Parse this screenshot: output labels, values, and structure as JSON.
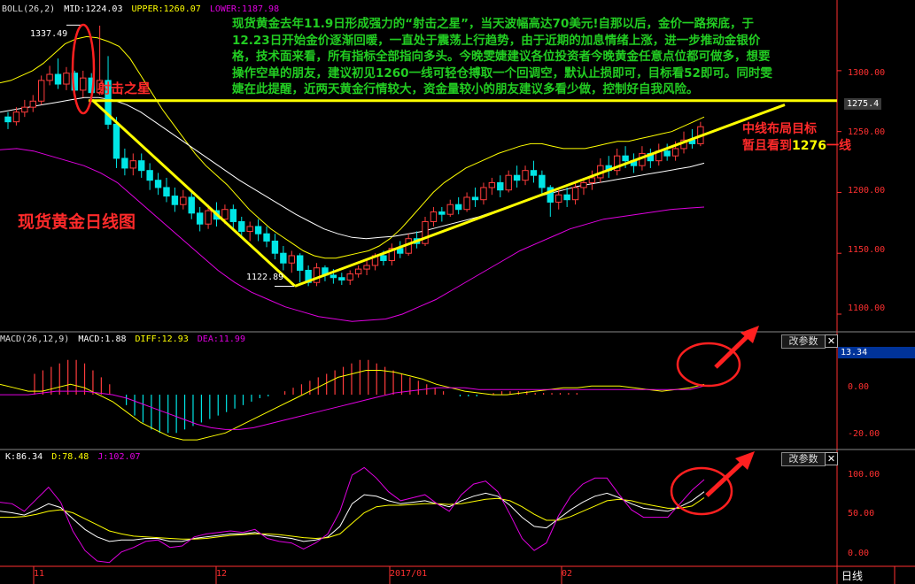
{
  "headers": {
    "boll": {
      "name": "BOLL(26,2)",
      "mid": "MID:1224.03",
      "upper": "UPPER:1260.07",
      "lower": "LOWER:1187.98"
    },
    "macd": {
      "name": "MACD(26,12,9)",
      "macd": "MACD:1.88",
      "diff": "DIFF:12.93",
      "dea": "DEA:11.99"
    },
    "kdj": {
      "k": "K:86.34",
      "d": "D:78.48",
      "j": "J:102.07"
    }
  },
  "buttons": {
    "params_label": "改参数",
    "close_label": "✕"
  },
  "annotations": {
    "main_text": "现货黄金去年11.9日形成强力的“射击之星”，当天波幅高达70美元!自那以后，金价一路探底，于12.23日开始金价逐渐回暖，一直处于震荡上行趋势，由于近期的加息情绪上涨，进一步推动金银价格，技术面来看，所有指标全部指向多头。今晚雯婕建议各位投资者今晚黄金任意点位都可做多，想要操作空单的朋友，建议初见1260一线可轻仓搏取一个回调空，默认止损即可，目标看52即可。同时雯婕在此提醒，近两天黄金行情较大，资金量较小的朋友建议多看少做，控制好自我风险。",
    "star_label": "射击之星",
    "chart_title": "现货黄金日线图",
    "target_line1": "中线布局目标",
    "target_line2_prefix": "暂且看到",
    "target_line2_value": "1276",
    "target_line2_suffix": "一线"
  },
  "price_labels": {
    "high": "1337.49",
    "low": "1122.89",
    "current": "1275.4",
    "macd_current": "13.34"
  },
  "axis": {
    "price_ticks": [
      "1300.00",
      "1250.00",
      "1200.00",
      "1150.00",
      "1100.00"
    ],
    "macd_ticks": [
      "0.00",
      "-20.00"
    ],
    "kdj_ticks": [
      "100.00",
      "50.00",
      "0.00"
    ],
    "time_labels": [
      "11",
      "12",
      "2017/01",
      "02"
    ],
    "period_label": "日线"
  },
  "colors": {
    "up": "#ff3c3c",
    "down": "#00e5e5",
    "yellow": "#ffff00",
    "mid": "#ffffff",
    "lower": "#e000e0",
    "k": "#ffffff",
    "d": "#ffff00",
    "j": "#e000e0",
    "axis": "#ff3030",
    "red_mark": "#ff2020"
  },
  "chart_data": {
    "type": "candlestick",
    "price_range": [
      1092,
      1345
    ],
    "macd_range": [
      -30,
      27
    ],
    "kdj_range": [
      -13,
      122
    ],
    "candles": [
      [
        1262,
        1258,
        1252,
        1266
      ],
      [
        1258,
        1266,
        1255,
        1270
      ],
      [
        1266,
        1270,
        1262,
        1276
      ],
      [
        1270,
        1275,
        1266,
        1280
      ],
      [
        1275,
        1292,
        1272,
        1296
      ],
      [
        1292,
        1297,
        1288,
        1304
      ],
      [
        1297,
        1289,
        1285,
        1310
      ],
      [
        1289,
        1298,
        1284,
        1303
      ],
      [
        1298,
        1284,
        1280,
        1300
      ],
      [
        1284,
        1294,
        1278,
        1300
      ],
      [
        1294,
        1282,
        1276,
        1298
      ],
      [
        1282,
        1292,
        1280,
        1337
      ],
      [
        1292,
        1256,
        1252,
        1312
      ],
      [
        1256,
        1228,
        1220,
        1262
      ],
      [
        1228,
        1220,
        1214,
        1236
      ],
      [
        1220,
        1226,
        1214,
        1232
      ],
      [
        1226,
        1218,
        1212,
        1232
      ],
      [
        1218,
        1210,
        1202,
        1224
      ],
      [
        1210,
        1204,
        1198,
        1216
      ],
      [
        1204,
        1197,
        1192,
        1212
      ],
      [
        1197,
        1190,
        1184,
        1204
      ],
      [
        1190,
        1196,
        1186,
        1202
      ],
      [
        1196,
        1183,
        1178,
        1200
      ],
      [
        1183,
        1174,
        1168,
        1188
      ],
      [
        1174,
        1185,
        1170,
        1190
      ],
      [
        1185,
        1178,
        1172,
        1192
      ],
      [
        1178,
        1186,
        1174,
        1190
      ],
      [
        1186,
        1176,
        1170,
        1190
      ],
      [
        1176,
        1168,
        1164,
        1180
      ],
      [
        1168,
        1172,
        1160,
        1176
      ],
      [
        1172,
        1166,
        1160,
        1178
      ],
      [
        1166,
        1160,
        1155,
        1172
      ],
      [
        1160,
        1150,
        1145,
        1166
      ],
      [
        1150,
        1142,
        1136,
        1156
      ],
      [
        1142,
        1148,
        1134,
        1152
      ],
      [
        1148,
        1136,
        1126,
        1150
      ],
      [
        1136,
        1126,
        1123,
        1140
      ],
      [
        1126,
        1138,
        1123,
        1142
      ],
      [
        1138,
        1132,
        1127,
        1140
      ],
      [
        1132,
        1130,
        1125,
        1137
      ],
      [
        1130,
        1128,
        1124,
        1134
      ],
      [
        1128,
        1133,
        1124,
        1136
      ],
      [
        1133,
        1137,
        1130,
        1140
      ],
      [
        1137,
        1140,
        1132,
        1144
      ],
      [
        1140,
        1148,
        1136,
        1150
      ],
      [
        1148,
        1144,
        1140,
        1152
      ],
      [
        1144,
        1154,
        1140,
        1158
      ],
      [
        1154,
        1150,
        1146,
        1160
      ],
      [
        1150,
        1162,
        1148,
        1166
      ],
      [
        1162,
        1158,
        1154,
        1168
      ],
      [
        1158,
        1176,
        1156,
        1180
      ],
      [
        1176,
        1184,
        1172,
        1188
      ],
      [
        1184,
        1182,
        1176,
        1188
      ],
      [
        1182,
        1190,
        1180,
        1194
      ],
      [
        1190,
        1186,
        1182,
        1196
      ],
      [
        1186,
        1196,
        1184,
        1200
      ],
      [
        1196,
        1194,
        1188,
        1204
      ],
      [
        1194,
        1204,
        1190,
        1208
      ],
      [
        1204,
        1208,
        1198,
        1212
      ],
      [
        1208,
        1202,
        1196,
        1214
      ],
      [
        1202,
        1214,
        1200,
        1218
      ],
      [
        1214,
        1210,
        1204,
        1222
      ],
      [
        1210,
        1218,
        1206,
        1222
      ],
      [
        1218,
        1214,
        1208,
        1226
      ],
      [
        1214,
        1204,
        1198,
        1218
      ],
      [
        1204,
        1192,
        1180,
        1206
      ],
      [
        1192,
        1198,
        1186,
        1202
      ],
      [
        1198,
        1194,
        1188,
        1204
      ],
      [
        1194,
        1204,
        1190,
        1208
      ],
      [
        1204,
        1208,
        1198,
        1212
      ],
      [
        1208,
        1212,
        1202,
        1218
      ],
      [
        1212,
        1222,
        1208,
        1228
      ],
      [
        1222,
        1218,
        1212,
        1230
      ],
      [
        1218,
        1230,
        1214,
        1236
      ],
      [
        1230,
        1226,
        1220,
        1238
      ],
      [
        1226,
        1222,
        1216,
        1232
      ],
      [
        1222,
        1232,
        1218,
        1238
      ],
      [
        1232,
        1226,
        1220,
        1236
      ],
      [
        1226,
        1234,
        1222,
        1240
      ],
      [
        1234,
        1230,
        1226,
        1240
      ],
      [
        1230,
        1236,
        1226,
        1242
      ],
      [
        1236,
        1243,
        1232,
        1250
      ],
      [
        1243,
        1240,
        1236,
        1252
      ],
      [
        1240,
        1254,
        1238,
        1258
      ]
    ],
    "boll_upper": [
      1290,
      1292,
      1296,
      1300,
      1306,
      1314,
      1322,
      1326,
      1328,
      1327,
      1324,
      1320,
      1310,
      1296,
      1282,
      1268,
      1256,
      1244,
      1232,
      1222,
      1214,
      1206,
      1196,
      1186,
      1178,
      1170,
      1164,
      1158,
      1152,
      1148,
      1146,
      1146,
      1148,
      1150,
      1152,
      1156,
      1162,
      1170,
      1180,
      1190,
      1200,
      1208,
      1214,
      1220,
      1224,
      1228,
      1232,
      1235,
      1238,
      1240,
      1240,
      1238,
      1236,
      1236,
      1236,
      1238,
      1240,
      1242,
      1242,
      1244,
      1246,
      1248,
      1250,
      1254,
      1258,
      1262
    ],
    "boll_mid": [
      1266,
      1268,
      1270,
      1272,
      1274,
      1276,
      1278,
      1278,
      1276,
      1272,
      1266,
      1258,
      1250,
      1242,
      1234,
      1226,
      1218,
      1210,
      1203,
      1196,
      1189,
      1182,
      1176,
      1170,
      1166,
      1163,
      1162,
      1163,
      1164,
      1166,
      1168,
      1171,
      1174,
      1177,
      1180,
      1184,
      1188,
      1192,
      1196,
      1199,
      1202,
      1205,
      1207,
      1209,
      1211,
      1213,
      1215,
      1217,
      1219,
      1221,
      1224
    ],
    "boll_lower": [
      1235,
      1236,
      1234,
      1230,
      1226,
      1222,
      1216,
      1208,
      1196,
      1184,
      1172,
      1160,
      1148,
      1136,
      1126,
      1118,
      1112,
      1106,
      1102,
      1098,
      1096,
      1094,
      1095,
      1096,
      1100,
      1106,
      1112,
      1120,
      1128,
      1136,
      1144,
      1152,
      1158,
      1164,
      1170,
      1174,
      1178,
      1180,
      1182,
      1184,
      1186,
      1187,
      1188
    ],
    "macd_hist": [
      12,
      14,
      16,
      18,
      20,
      20,
      18,
      14,
      10,
      6,
      0,
      -6,
      -12,
      -16,
      -20,
      -22,
      -22,
      -22,
      -20,
      -18,
      -16,
      -14,
      -12,
      -10,
      -8,
      -6,
      -4,
      -2,
      -1,
      0,
      2,
      4,
      6,
      8,
      10,
      12,
      14,
      16,
      18,
      20,
      20,
      18,
      16,
      14,
      12,
      10,
      8,
      6,
      4,
      2,
      0,
      -1,
      -1,
      -1,
      0,
      1,
      2,
      2,
      2,
      2,
      1,
      1,
      1,
      1,
      1,
      1
    ],
    "macd_diff": [
      6,
      4,
      2,
      2,
      4,
      6,
      4,
      0,
      -4,
      -10,
      -16,
      -20,
      -24,
      -26,
      -26,
      -24,
      -22,
      -18,
      -14,
      -10,
      -6,
      -2,
      2,
      6,
      10,
      12,
      14,
      14,
      13,
      11,
      9,
      6,
      4,
      2,
      1,
      0,
      0,
      1,
      2,
      3,
      4,
      4,
      5,
      5,
      5,
      4,
      3,
      2,
      3,
      4,
      6
    ],
    "macd_dea": [
      0,
      0,
      0,
      1,
      2,
      2,
      2,
      1,
      0,
      -2,
      -5,
      -8,
      -11,
      -14,
      -17,
      -19,
      -20,
      -20,
      -19,
      -17,
      -15,
      -13,
      -11,
      -9,
      -7,
      -5,
      -3,
      -1,
      1,
      2,
      3,
      4,
      4,
      4,
      3,
      3,
      3,
      3,
      3,
      3,
      3,
      3,
      3,
      3,
      3,
      3,
      3,
      3,
      3,
      3,
      5
    ],
    "kdj_k": [
      60,
      58,
      55,
      62,
      70,
      65,
      50,
      36,
      26,
      20,
      22,
      22,
      24,
      24,
      20,
      20,
      24,
      26,
      28,
      30,
      30,
      32,
      28,
      26,
      24,
      20,
      22,
      26,
      40,
      70,
      82,
      80,
      74,
      70,
      72,
      74,
      70,
      66,
      74,
      80,
      84,
      80,
      68,
      52,
      40,
      38,
      50,
      62,
      72,
      80,
      84,
      78,
      70,
      64,
      62,
      60,
      66,
      74,
      86
    ],
    "kdj_d": [
      52,
      52,
      53,
      56,
      60,
      62,
      58,
      50,
      42,
      34,
      30,
      27,
      26,
      25,
      24,
      23,
      23,
      24,
      26,
      28,
      29,
      30,
      30,
      29,
      27,
      25,
      24,
      25,
      30,
      44,
      58,
      66,
      68,
      68,
      69,
      70,
      70,
      69,
      70,
      73,
      76,
      77,
      74,
      66,
      56,
      48,
      48,
      53,
      60,
      67,
      74,
      76,
      74,
      70,
      67,
      64,
      64,
      67,
      78
    ],
    "kdj_j": [
      72,
      70,
      60,
      76,
      92,
      72,
      34,
      8,
      -6,
      -8,
      6,
      12,
      20,
      22,
      12,
      14,
      26,
      30,
      32,
      34,
      32,
      36,
      24,
      20,
      18,
      10,
      18,
      30,
      60,
      108,
      118,
      104,
      86,
      74,
      78,
      82,
      70,
      60,
      82,
      96,
      100,
      86,
      56,
      24,
      8,
      18,
      54,
      80,
      96,
      104,
      104,
      82,
      62,
      52,
      52,
      52,
      70,
      88,
      102
    ]
  }
}
